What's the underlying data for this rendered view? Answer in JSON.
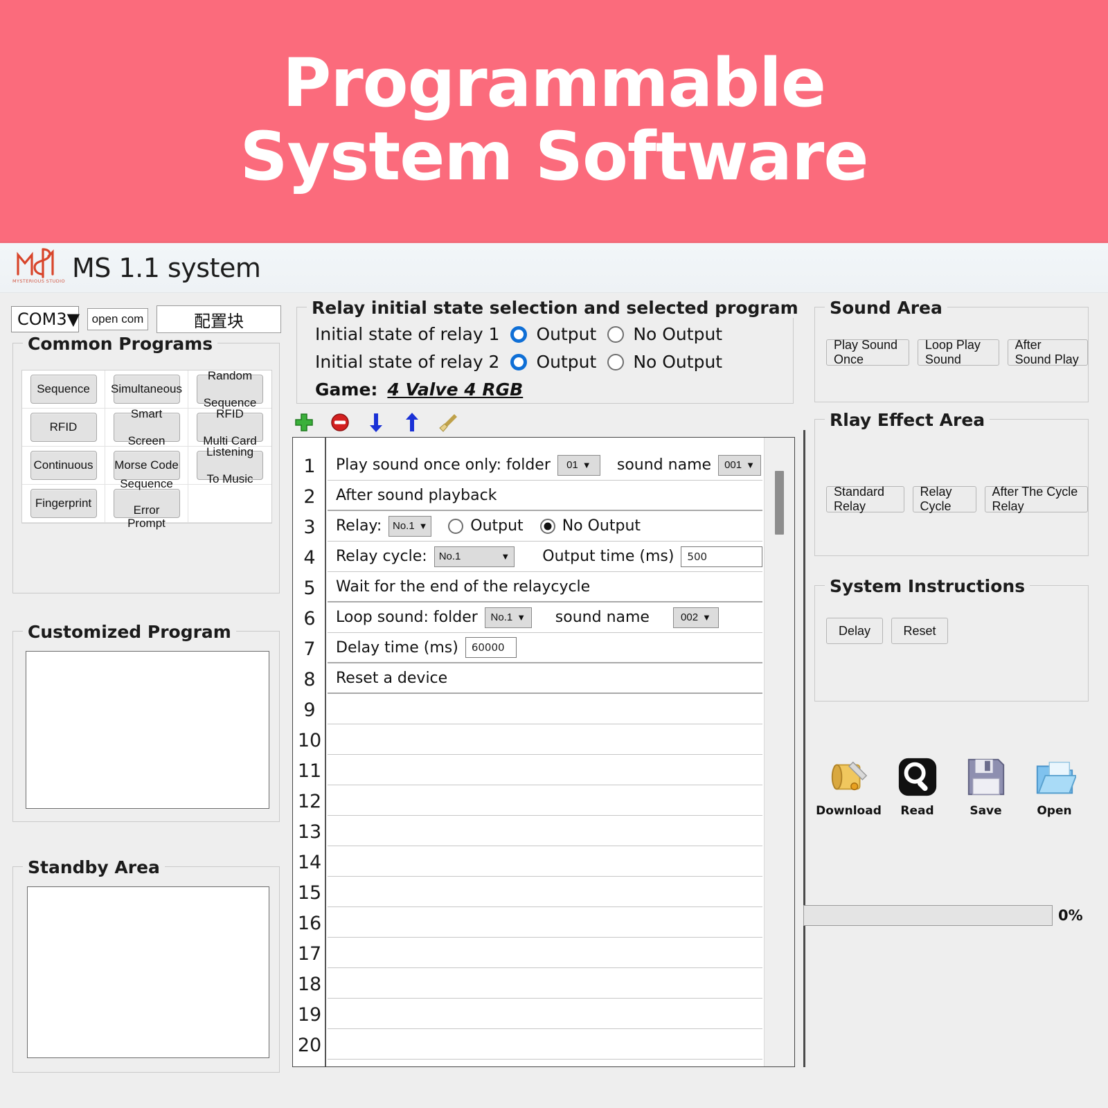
{
  "banner": {
    "line1": "Programmable",
    "line2": "System Software",
    "bg_color": "#fb6b7c",
    "text_color": "#ffffff"
  },
  "titlebar": {
    "app_title": "MS 1.1 system",
    "logo_caption": "MYSTERIOUS STUDIO",
    "logo_color": "#d8452b"
  },
  "connection": {
    "port_value": "COM3",
    "open_com_label": "open com",
    "config_block_label": "配置块"
  },
  "common_programs": {
    "legend": "Common Programs",
    "buttons": [
      "Sequence",
      "Simultaneous",
      "Random\nSequence",
      "RFID",
      "Smart\nScreen",
      "RFID\nMulti Card",
      "Continuous",
      "Morse Code",
      "Listening\nTo Music",
      "Fingerprint",
      "Sequence\nError Prompt",
      ""
    ]
  },
  "customized_program": {
    "legend": "Customized Program",
    "content": ""
  },
  "standby_area": {
    "legend": "Standby Area",
    "content": ""
  },
  "relay_state": {
    "legend": "Relay initial state selection and selected program",
    "relay1_label": "Initial state of relay 1",
    "relay2_label": "Initial state of relay 2",
    "output_label": "Output",
    "no_output_label": "No Output",
    "relay1_selected": "Output",
    "relay2_selected": "Output",
    "game_label": "Game:",
    "game_value": "4 Valve 4 RGB",
    "selected_color": "#0f6fd6"
  },
  "toolbar": {
    "add_label": "add",
    "remove_label": "remove",
    "move_down_label": "move down",
    "move_up_label": "move up",
    "clear_label": "clear"
  },
  "program_list": {
    "total_rows": 20,
    "scroll_position": "top",
    "rows": [
      {
        "n": "1",
        "type": "play_sound_once",
        "label": "Play sound once only: folder",
        "folder_value": "01",
        "sound_name_label": "sound name",
        "sound_value": "001"
      },
      {
        "n": "2",
        "type": "text",
        "label": "After sound playback"
      },
      {
        "n": "3",
        "type": "relay",
        "label": "Relay:",
        "relay_value": "No.1",
        "output_label": "Output",
        "no_output_label": "No Output",
        "selected": "No Output"
      },
      {
        "n": "4",
        "type": "relay_cycle",
        "label": "Relay cycle:",
        "cycle_value": "No.1",
        "output_time_label": "Output time (ms)",
        "output_time_value": "500"
      },
      {
        "n": "5",
        "type": "text",
        "label": "Wait for the end of the relaycycle"
      },
      {
        "n": "6",
        "type": "loop_sound",
        "label": "Loop sound: folder",
        "folder_value": "No.1",
        "sound_name_label": "sound name",
        "sound_value": "002"
      },
      {
        "n": "7",
        "type": "delay",
        "label": "Delay time (ms)",
        "delay_value": "60000"
      },
      {
        "n": "8",
        "type": "text",
        "label": "Reset a device"
      },
      {
        "n": "9",
        "type": "empty",
        "label": ""
      },
      {
        "n": "10",
        "type": "empty",
        "label": ""
      },
      {
        "n": "11",
        "type": "empty",
        "label": ""
      },
      {
        "n": "12",
        "type": "empty",
        "label": ""
      },
      {
        "n": "13",
        "type": "empty",
        "label": ""
      },
      {
        "n": "14",
        "type": "empty",
        "label": ""
      },
      {
        "n": "15",
        "type": "empty",
        "label": ""
      },
      {
        "n": "16",
        "type": "empty",
        "label": ""
      },
      {
        "n": "17",
        "type": "empty",
        "label": ""
      },
      {
        "n": "18",
        "type": "empty",
        "label": ""
      },
      {
        "n": "19",
        "type": "empty",
        "label": ""
      },
      {
        "n": "20",
        "type": "empty",
        "label": ""
      }
    ]
  },
  "sound_area": {
    "legend": "Sound Area",
    "buttons": [
      "Play Sound Once",
      "Loop Play Sound",
      "After Sound Play"
    ]
  },
  "relay_effect_area": {
    "legend": "Rlay Effect Area",
    "buttons": [
      "Standard Relay",
      "Relay Cycle",
      "After The Cycle Relay"
    ]
  },
  "system_instructions": {
    "legend": "System Instructions",
    "buttons": [
      "Delay",
      "Reset"
    ]
  },
  "file_actions": [
    {
      "label": "Download",
      "icon": "scroll-quill-icon"
    },
    {
      "label": "Read",
      "icon": "magnifier-icon"
    },
    {
      "label": "Save",
      "icon": "floppy-disk-icon"
    },
    {
      "label": "Open",
      "icon": "open-folder-icon"
    }
  ],
  "progress": {
    "value": "0%",
    "percent": 0
  }
}
